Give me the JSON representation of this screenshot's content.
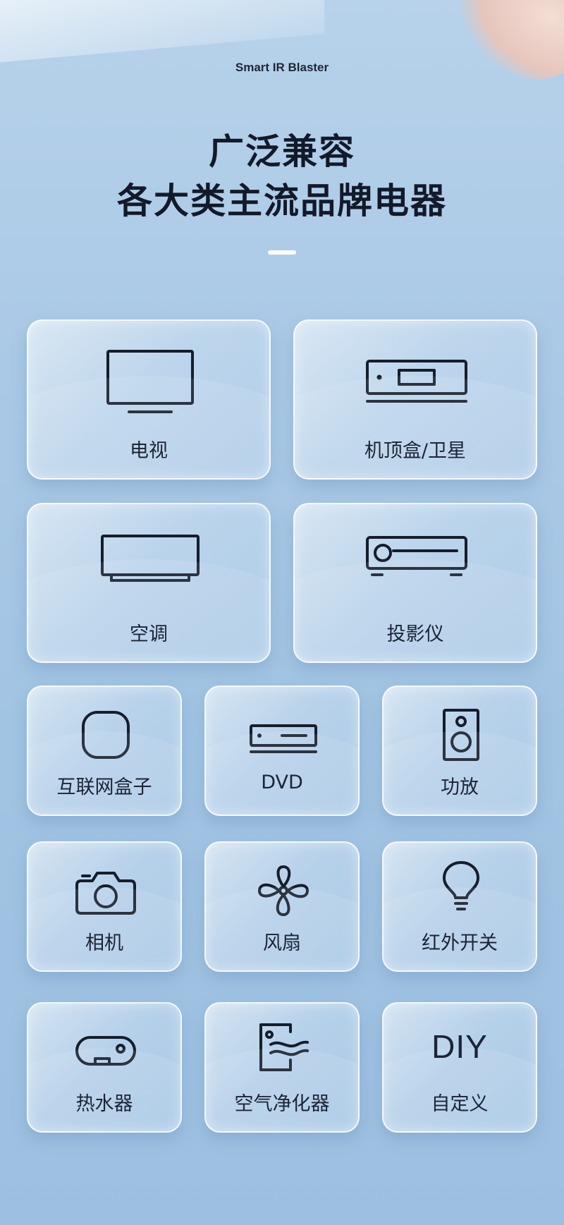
{
  "header": {
    "subtitle": "Smart IR Blaster",
    "title_line1": "广泛兼容",
    "title_line2": "各大类主流品牌电器"
  },
  "devices": [
    {
      "label": "电视",
      "icon": "tv-icon"
    },
    {
      "label": "机顶盒/卫星",
      "icon": "set-top-box-icon"
    },
    {
      "label": "空调",
      "icon": "air-conditioner-icon"
    },
    {
      "label": "投影仪",
      "icon": "projector-icon"
    },
    {
      "label": "互联网盒子",
      "icon": "internet-box-icon"
    },
    {
      "label": "DVD",
      "icon": "dvd-player-icon"
    },
    {
      "label": "功放",
      "icon": "speaker-icon"
    },
    {
      "label": "相机",
      "icon": "camera-icon"
    },
    {
      "label": "风扇",
      "icon": "fan-icon"
    },
    {
      "label": "红外开关",
      "icon": "light-bulb-icon"
    },
    {
      "label": "热水器",
      "icon": "water-heater-icon"
    },
    {
      "label": "空气净化器",
      "icon": "air-purifier-icon"
    },
    {
      "label": "自定义",
      "icon": "diy-icon",
      "icon_text": "DIY"
    }
  ],
  "colors": {
    "background": "#a7c7e5",
    "icon_stroke": "#151d2b",
    "text": "#1b2434",
    "card_border": "#ffffff"
  }
}
